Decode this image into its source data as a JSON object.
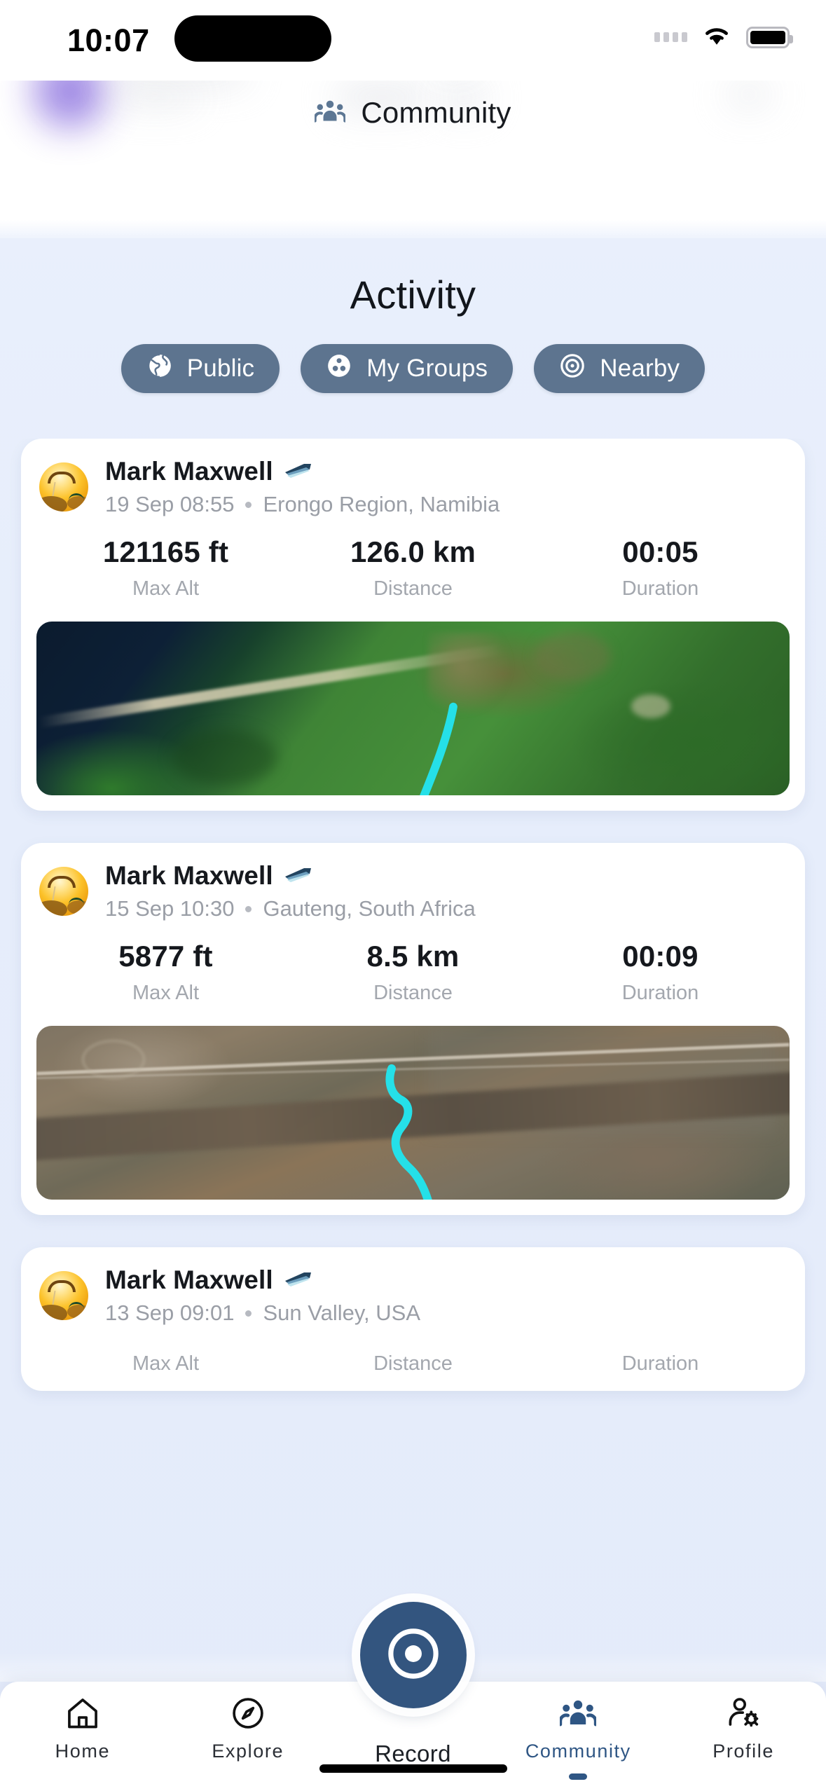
{
  "status_bar": {
    "time": "10:07",
    "wifi_icon": "wifi-icon",
    "battery_icon": "battery-icon",
    "signal_icon": "signal-dots-icon"
  },
  "header": {
    "title": "Community",
    "icon": "people-group-icon"
  },
  "feed": {
    "title": "Activity",
    "filters": [
      {
        "label": "Public",
        "icon": "globe-icon",
        "active": true
      },
      {
        "label": "My Groups",
        "icon": "group-icon",
        "active": false
      },
      {
        "label": "Nearby",
        "icon": "at-target-icon",
        "active": false
      }
    ],
    "stat_labels": {
      "max_alt": "Max Alt",
      "distance": "Distance",
      "duration": "Duration"
    },
    "activities": [
      {
        "user": "Mark Maxwell",
        "badge_icon": "paraglider-wing-icon",
        "avatar_icon": "paraglider-sunset-avatar",
        "date": "19 Sep 08:55",
        "location": "Erongo Region, Namibia",
        "max_alt": "121165 ft",
        "distance": "126.0 km",
        "duration": "00:05",
        "map_style": "coastal-satellite",
        "track_color": "#25e0e8"
      },
      {
        "user": "Mark Maxwell",
        "badge_icon": "paraglider-wing-icon",
        "avatar_icon": "paraglider-sunset-avatar",
        "date": "15 Sep 10:30",
        "location": "Gauteng, South Africa",
        "max_alt": "5877 ft",
        "distance": "8.5 km",
        "duration": "00:09",
        "map_style": "terrain-satellite",
        "track_color": "#25e0e8"
      },
      {
        "user": "Mark Maxwell",
        "badge_icon": "paraglider-wing-icon",
        "avatar_icon": "paraglider-sunset-avatar",
        "date": "13 Sep 09:01",
        "location": "Sun Valley, USA",
        "max_alt": "",
        "distance": "",
        "duration": "",
        "map_style": "",
        "track_color": "#25e0e8"
      }
    ]
  },
  "bottom_nav": {
    "items": [
      {
        "label": "Home",
        "icon": "home-icon",
        "active": false
      },
      {
        "label": "Explore",
        "icon": "compass-icon",
        "active": false
      },
      {
        "label": "Record",
        "icon": "record-target-icon",
        "active": false
      },
      {
        "label": "Community",
        "icon": "people-group-icon",
        "active": true
      },
      {
        "label": "Profile",
        "icon": "person-gear-icon",
        "active": false
      }
    ]
  },
  "colors": {
    "accent": "#33557f",
    "chip_bg": "#5d748f",
    "active_nav": "#2f5684",
    "track": "#25e0e8",
    "page_bg": "#e8eefb"
  }
}
